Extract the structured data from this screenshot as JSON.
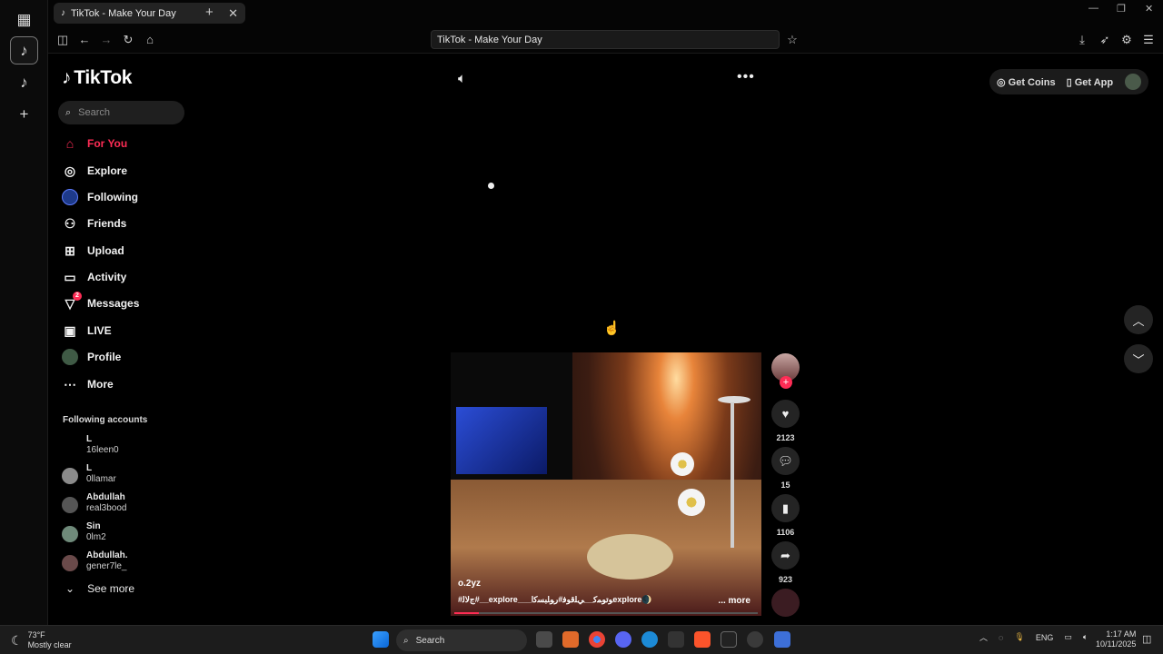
{
  "browser": {
    "tab_title": "TikTok - Make Your Day",
    "url_text": "TikTok - Make Your Day",
    "new_tab": "+"
  },
  "tiktok": {
    "logo_text": "TikTok",
    "search_placeholder": "Search",
    "nav": [
      {
        "label": "For You"
      },
      {
        "label": "Explore"
      },
      {
        "label": "Following"
      },
      {
        "label": "Friends"
      },
      {
        "label": "Upload"
      },
      {
        "label": "Activity"
      },
      {
        "label": "Messages",
        "badge": "2"
      },
      {
        "label": "LIVE"
      },
      {
        "label": "Profile"
      },
      {
        "label": "More"
      }
    ],
    "following_header": "Following accounts",
    "accounts": [
      {
        "name": "L",
        "handle": "16leen0"
      },
      {
        "name": "L",
        "handle": "0llamar"
      },
      {
        "name": "Abdullah",
        "handle": "real3bood"
      },
      {
        "name": "Sin",
        "handle": "0lm2"
      },
      {
        "name": "Abdullah.",
        "handle": "gener7le_"
      }
    ],
    "see_more": "See more",
    "top_right": {
      "coins": "Get Coins",
      "app": "Get App"
    },
    "video": {
      "username": "o.2yz",
      "caption": "#ﺝﻟﺎﻟ#__explore___ﻮﺗﻮﻤﻛ__ﻲﻠﻗﻮﻓ#ﺭﻮﻠﺒﺴﻛﺍexplore🌒",
      "more": "... more",
      "progress": 0.08
    },
    "actions": {
      "likes": "2123",
      "comments": "15",
      "saves": "1106",
      "shares": "923"
    }
  },
  "taskbar": {
    "temp": "73°F",
    "weather": "Mostly clear",
    "search": "Search",
    "lang": "ENG",
    "time": "1:17 AM",
    "date": "10/11/2025"
  }
}
